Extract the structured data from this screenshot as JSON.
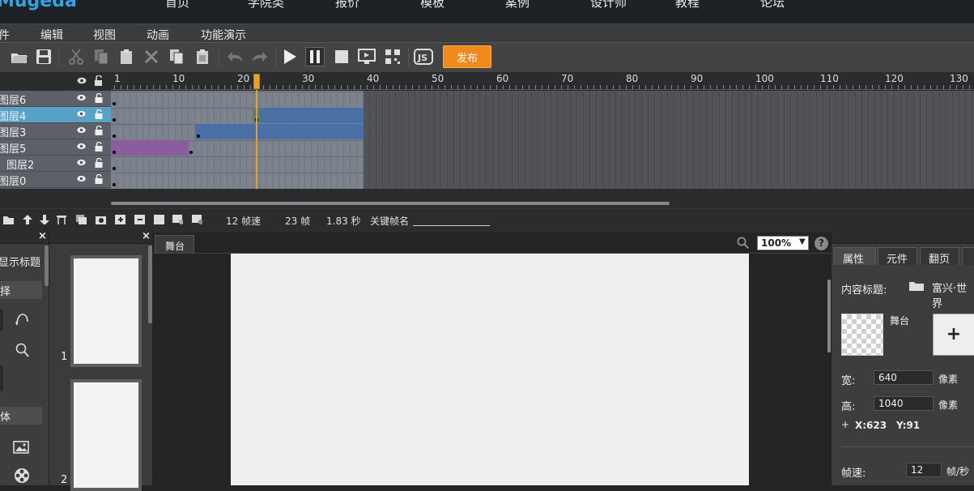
{
  "topnav": {
    "logo": "Mugeda",
    "items": [
      "首页",
      "学院类",
      "报价",
      "模板",
      "案例",
      "设计师",
      "教程",
      "论坛"
    ]
  },
  "menubar": {
    "items": [
      "件",
      "编辑",
      "视图",
      "动画",
      "功能演示"
    ]
  },
  "toolbar": {
    "publish": "发布"
  },
  "timeline": {
    "ruler": [
      "1",
      "10",
      "20",
      "30",
      "40",
      "50",
      "60",
      "70",
      "80",
      "90",
      "100",
      "110",
      "120",
      "130"
    ],
    "layers": [
      {
        "name": "图层6",
        "selected": false
      },
      {
        "name": "图层4",
        "selected": true
      },
      {
        "name": "图层3",
        "selected": false
      },
      {
        "name": "图层5",
        "selected": false
      },
      {
        "name": "图层2",
        "selected": false
      },
      {
        "name": "图层0",
        "selected": false
      }
    ],
    "current_frame": 21,
    "colors": {
      "accent": "#e3a32c",
      "tween_blue": "#4a6fa5",
      "tween_purple": "#8b5c9e"
    }
  },
  "timeline_status": {
    "fps": "12 帧速",
    "frames": "23 帧",
    "seconds": "1.83 秒",
    "keyframe_label": "关键帧名"
  },
  "left_panel": {
    "title": "显示标题",
    "select_label": "择",
    "body_label": "体"
  },
  "thumbs": {
    "items": [
      "1",
      "2"
    ]
  },
  "stage": {
    "tab": "舞台",
    "zoom": "100%"
  },
  "right_panel": {
    "tabs": [
      "属性",
      "元件",
      "翻页",
      ""
    ],
    "content_title_label": "内容标题:",
    "content_title_value": "富兴·世界",
    "stage_label": "舞台",
    "width_label": "宽:",
    "width_value": "640",
    "width_unit": "像素",
    "height_label": "高:",
    "height_value": "1040",
    "height_unit": "像素",
    "coord_x": "X:623",
    "coord_y": "Y:91",
    "fps_label": "帧速:",
    "fps_value": "12",
    "fps_unit": "帧/秒"
  }
}
